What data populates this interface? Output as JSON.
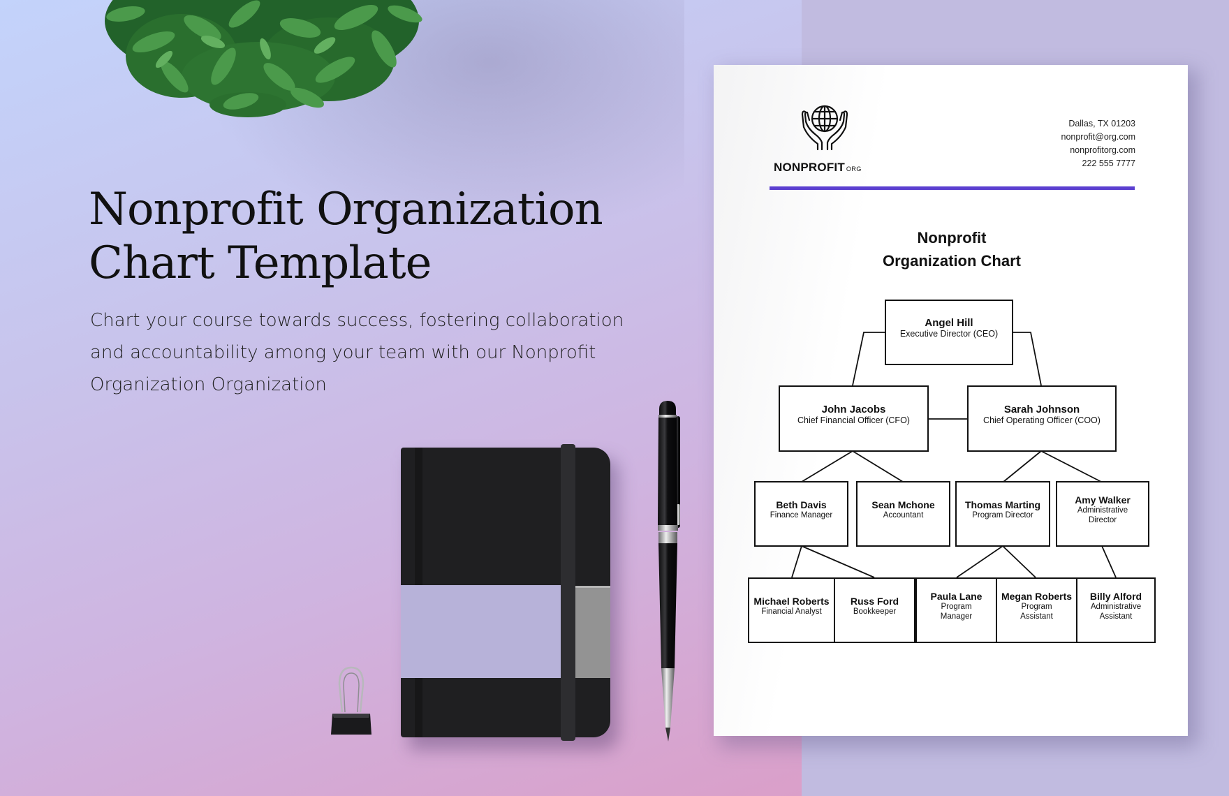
{
  "hero": {
    "title_lines": [
      "Nonprofit Organization",
      "Chart Template"
    ],
    "body_lines": [
      "Chart your course towards success, fostering collaboration",
      "and accountability among your team with our Nonprofit",
      "Organization Organization"
    ]
  },
  "document": {
    "logo": {
      "icon": "globe-in-hands-icon",
      "name": "NONPROFIT",
      "suffix": "ORG"
    },
    "contact": {
      "address": "Dallas, TX 01203",
      "email": "nonprofit@org.com",
      "website": "nonprofitorg.com",
      "phone": "222 555 7777"
    },
    "accent_color": "#5b3fd0",
    "title_lines": [
      "Nonprofit",
      "Organization Chart"
    ],
    "org_chart": {
      "nodes": [
        {
          "id": "ceo",
          "name": "Angel Hill",
          "role": "Executive Director (CEO)",
          "parent": null
        },
        {
          "id": "cfo",
          "name": "John Jacobs",
          "role": "Chief Financial Officer (CFO)",
          "parent": "ceo"
        },
        {
          "id": "coo",
          "name": "Sarah Johnson",
          "role": "Chief Operating Officer (COO)",
          "parent": "ceo"
        },
        {
          "id": "beth",
          "name": "Beth Davis",
          "role": "Finance Manager",
          "parent": "cfo"
        },
        {
          "id": "sean",
          "name": "Sean Mchone",
          "role": "Accountant",
          "parent": "cfo"
        },
        {
          "id": "thomas",
          "name": "Thomas Marting",
          "role": "Program Director",
          "parent": "coo"
        },
        {
          "id": "amy",
          "name": "Amy Walker",
          "role": "Administrative Director",
          "parent": "coo"
        },
        {
          "id": "michael",
          "name": "Michael Roberts",
          "role": "Financial Analyst",
          "parent": "beth"
        },
        {
          "id": "russ",
          "name": "Russ Ford",
          "role": "Bookkeeper",
          "parent": "beth"
        },
        {
          "id": "paula",
          "name": "Paula Lane",
          "role": "Program Manager",
          "parent": "thomas"
        },
        {
          "id": "megan",
          "name": "Megan Roberts",
          "role": "Program Assistant",
          "parent": "thomas"
        },
        {
          "id": "billy",
          "name": "Billy Alford",
          "role": "Administrative Assistant",
          "parent": "amy"
        }
      ],
      "peer_links": [
        [
          "cfo",
          "coo"
        ]
      ]
    }
  },
  "colors": {
    "accent": "#5b3fd0",
    "notebook_label": "#b7b2d9",
    "background_right": "#c1bbe0"
  }
}
